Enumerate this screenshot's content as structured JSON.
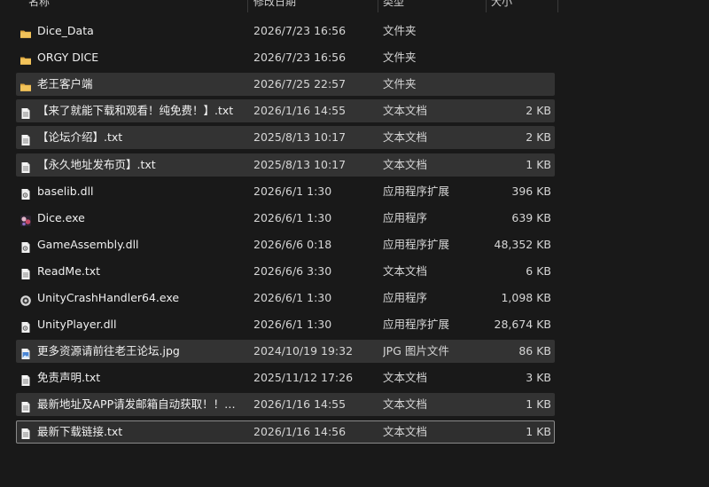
{
  "columns": {
    "name": "名称",
    "date": "修改日期",
    "type": "类型",
    "size": "大小"
  },
  "files": [
    {
      "name": "Dice_Data",
      "date": "2026/7/23 16:56",
      "type": "文件夹",
      "size": "",
      "icon": "folder-icon",
      "state": "normal"
    },
    {
      "name": "ORGY DICE",
      "date": "2026/7/23 16:56",
      "type": "文件夹",
      "size": "",
      "icon": "folder-icon",
      "state": "normal"
    },
    {
      "name": "老王客户端",
      "date": "2026/7/25 22:57",
      "type": "文件夹",
      "size": "",
      "icon": "folder-icon",
      "state": "selected"
    },
    {
      "name": "【来了就能下载和观看！纯免费！】.txt",
      "date": "2026/1/16 14:55",
      "type": "文本文档",
      "size": "2 KB",
      "icon": "text-file-icon",
      "state": "selected"
    },
    {
      "name": "【论坛介绍】.txt",
      "date": "2025/8/13 10:17",
      "type": "文本文档",
      "size": "2 KB",
      "icon": "text-file-icon",
      "state": "selected"
    },
    {
      "name": "【永久地址发布页】.txt",
      "date": "2025/8/13 10:17",
      "type": "文本文档",
      "size": "1 KB",
      "icon": "text-file-icon",
      "state": "selected"
    },
    {
      "name": "baselib.dll",
      "date": "2026/6/1 1:30",
      "type": "应用程序扩展",
      "size": "396 KB",
      "icon": "dll-file-icon",
      "state": "normal"
    },
    {
      "name": "Dice.exe",
      "date": "2026/6/1 1:30",
      "type": "应用程序",
      "size": "639 KB",
      "icon": "dice-app-icon",
      "state": "normal"
    },
    {
      "name": "GameAssembly.dll",
      "date": "2026/6/6 0:18",
      "type": "应用程序扩展",
      "size": "48,352 KB",
      "icon": "dll-file-icon",
      "state": "normal"
    },
    {
      "name": "ReadMe.txt",
      "date": "2026/6/6 3:30",
      "type": "文本文档",
      "size": "6 KB",
      "icon": "text-file-icon",
      "state": "normal"
    },
    {
      "name": "UnityCrashHandler64.exe",
      "date": "2026/6/1 1:30",
      "type": "应用程序",
      "size": "1,098 KB",
      "icon": "unity-app-icon",
      "state": "normal"
    },
    {
      "name": "UnityPlayer.dll",
      "date": "2026/6/1 1:30",
      "type": "应用程序扩展",
      "size": "28,674 KB",
      "icon": "dll-file-icon",
      "state": "normal"
    },
    {
      "name": "更多资源请前往老王论坛.jpg",
      "date": "2024/10/19 19:32",
      "type": "JPG 图片文件",
      "size": "86 KB",
      "icon": "image-file-icon",
      "state": "selected"
    },
    {
      "name": "免责声明.txt",
      "date": "2025/11/12 17:26",
      "type": "文本文档",
      "size": "3 KB",
      "icon": "text-file-icon",
      "state": "normal"
    },
    {
      "name": "最新地址及APP请发邮箱自动获取！！！.txt",
      "date": "2026/1/16 14:55",
      "type": "文本文档",
      "size": "1 KB",
      "icon": "text-file-icon",
      "state": "selected"
    },
    {
      "name": "最新下载链接.txt",
      "date": "2026/1/16 14:56",
      "type": "文本文档",
      "size": "1 KB",
      "icon": "text-file-icon",
      "state": "focused"
    }
  ],
  "colors": {
    "background": "#191919",
    "selected": "#333333",
    "folder": "#e8b64c",
    "text": "#e6e6e6"
  }
}
